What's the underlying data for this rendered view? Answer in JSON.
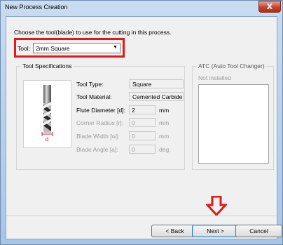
{
  "window": {
    "title": "New Process Creation",
    "close_glyph": "X"
  },
  "prompt": "Choose the tool(blade) to use for the cutting in this process.",
  "tool_selector": {
    "label": "Tool:",
    "value": "2mm Square"
  },
  "tool_specifications": {
    "title": "Tool Specifications",
    "image_dim_label": "d",
    "fields": [
      {
        "label": "Tool Type:",
        "value": "Square",
        "unit": "",
        "enabled": true
      },
      {
        "label": "Tool Material:",
        "value": "Cemented Carbide",
        "unit": "",
        "enabled": true
      },
      {
        "label": "Flute Diameter [d]:",
        "value": "2",
        "unit": "mm",
        "enabled": true
      },
      {
        "label": "Corner Radius [r]:",
        "value": "0",
        "unit": "mm",
        "enabled": false
      },
      {
        "label": "Blade Width [w]:",
        "value": "0",
        "unit": "mm",
        "enabled": false
      },
      {
        "label": "Blade Angle [a]:",
        "value": "0",
        "unit": "deg.",
        "enabled": false
      }
    ]
  },
  "atc": {
    "title": "ATC (Auto Tool Changer)",
    "status": "Not installed"
  },
  "buttons": {
    "back": "< Back",
    "next": "Next >",
    "cancel": "Cancel"
  },
  "colors": {
    "highlight": "#e01a1a",
    "accent": "#3c7fb1"
  }
}
